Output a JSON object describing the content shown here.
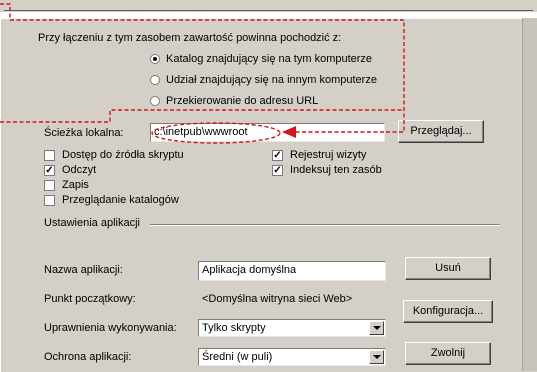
{
  "content_source": {
    "heading": "Przy łączeniu z tym zasobem zawartość powinna pochodzić z:",
    "options": [
      {
        "label": "Katalog znajdujący się na tym komputerze",
        "selected": true
      },
      {
        "label": "Udział znajdujący się na innym komputerze",
        "selected": false
      },
      {
        "label": "Przekierowanie do adresu URL",
        "selected": false
      }
    ]
  },
  "local_path": {
    "label": "Ścieżka lokalna:",
    "value": "c:\\inetpub\\wwwroot",
    "browse_label": "Przeglądaj..."
  },
  "permissions_left": [
    {
      "label": "Dostęp do źródła skryptu",
      "checked": false
    },
    {
      "label": "Odczyt",
      "checked": true
    },
    {
      "label": "Zapis",
      "checked": false
    },
    {
      "label": "Przeglądanie katalogów",
      "checked": false
    }
  ],
  "permissions_right": [
    {
      "label": "Rejestruj wizyty",
      "checked": true
    },
    {
      "label": "Indeksuj ten zasób",
      "checked": true
    }
  ],
  "app_settings": {
    "section_label": "Ustawienia aplikacji",
    "name_label": "Nazwa aplikacji:",
    "name_value": "Aplikacja domyślna",
    "remove_label": "Usuń",
    "start_point_label": "Punkt początkowy:",
    "start_point_value": "<Domyślna witryna sieci Web>",
    "config_label": "Konfiguracja...",
    "exec_perm_label": "Uprawnienia wykonywania:",
    "exec_perm_value": "Tylko skrypty",
    "protection_label": "Ochrona aplikacji:",
    "protection_value": "Średni (w puli)",
    "unload_label": "Zwolnij"
  },
  "annotation_color": "#d4141c",
  "check_mark": "✓"
}
